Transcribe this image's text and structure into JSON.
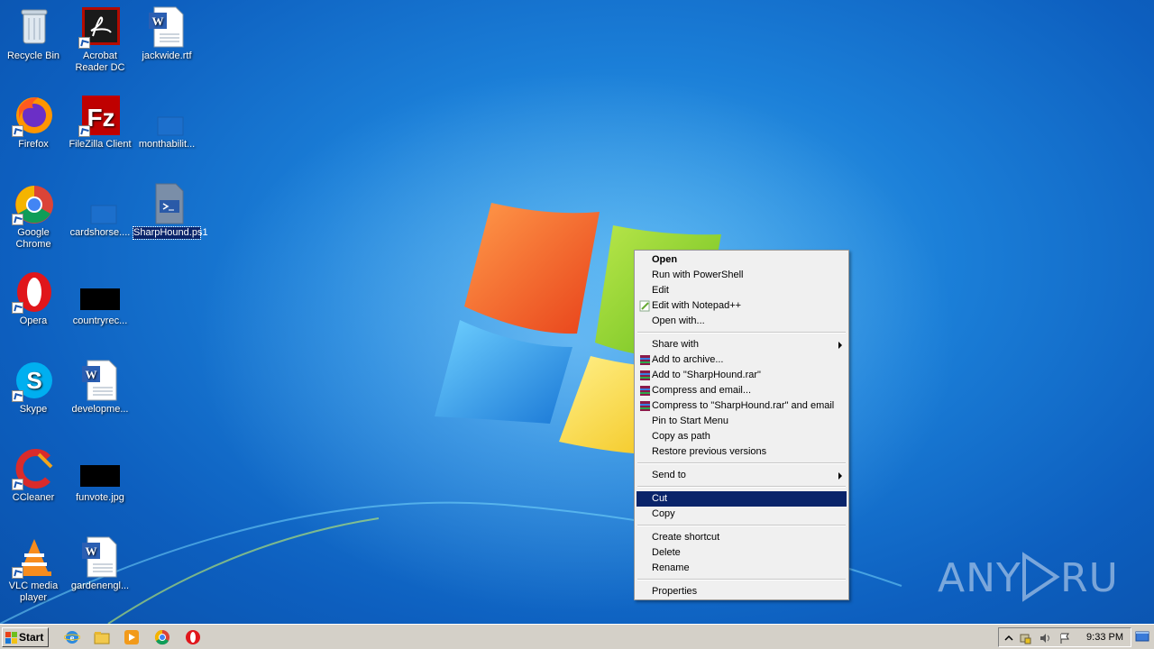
{
  "desktop": {
    "icons": [
      {
        "label": "Recycle Bin"
      },
      {
        "label": "Acrobat Reader DC"
      },
      {
        "label": "jackwide.rtf"
      },
      {
        "label": "Firefox"
      },
      {
        "label": "FileZilla Client"
      },
      {
        "label": "monthabilit..."
      },
      {
        "label": "Google Chrome"
      },
      {
        "label": "cardshorse...."
      },
      {
        "label": "SharpHound.ps1"
      },
      {
        "label": "Opera"
      },
      {
        "label": "countryrec..."
      },
      {
        "label": "Skype"
      },
      {
        "label": "developme..."
      },
      {
        "label": "CCleaner"
      },
      {
        "label": "funvote.jpg"
      },
      {
        "label": "VLC media player"
      },
      {
        "label": "gardenengl..."
      }
    ]
  },
  "context_menu": {
    "items": [
      {
        "label": "Open"
      },
      {
        "label": "Run with PowerShell"
      },
      {
        "label": "Edit"
      },
      {
        "label": "Edit with Notepad++"
      },
      {
        "label": "Open with..."
      },
      {
        "label": "Share with"
      },
      {
        "label": "Add to archive..."
      },
      {
        "label": "Add to \"SharpHound.rar\""
      },
      {
        "label": "Compress and email..."
      },
      {
        "label": "Compress to \"SharpHound.rar\" and email"
      },
      {
        "label": "Pin to Start Menu"
      },
      {
        "label": "Copy as path"
      },
      {
        "label": "Restore previous versions"
      },
      {
        "label": "Send to"
      },
      {
        "label": "Cut"
      },
      {
        "label": "Copy"
      },
      {
        "label": "Create shortcut"
      },
      {
        "label": "Delete"
      },
      {
        "label": "Rename"
      },
      {
        "label": "Properties"
      }
    ],
    "highlighted": "Cut"
  },
  "taskbar": {
    "start_label": "Start",
    "clock": "9:33 PM",
    "pinned": [
      "internet-explorer-icon",
      "explorer-icon",
      "media-player-icon",
      "chrome-icon",
      "opera-icon"
    ]
  },
  "watermark": {
    "text": "ANY RUN"
  },
  "colors": {
    "highlight": "#0a246a",
    "menu_bg": "#f0f0f0",
    "taskbar": "#d4d0c8"
  }
}
